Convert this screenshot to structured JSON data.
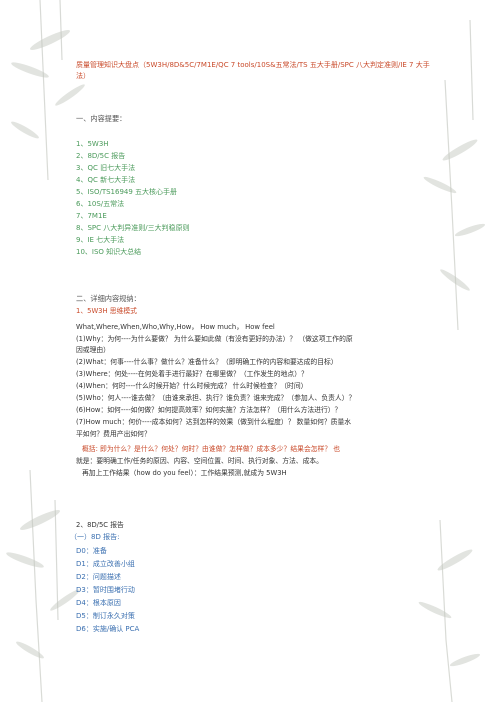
{
  "title": "质量管理知识大盘点（5W3H/8D&5C/7M1E/QC 7 tools/10S&五常法/TS 五大手册/SPC 八大判定准则/IE 7 大手法）",
  "section1": {
    "heading": "一、内容提要：",
    "items": [
      "1、5W3H",
      "2、8D/5C 报告",
      "3、QC 旧七大手法",
      "4、QC 新七大手法",
      "5、ISO/TS16949 五大核心手册",
      "6、10S/五常法",
      "7、7M1E",
      "8、SPC 八大判异准则/三大判稳原则",
      "9、IE 七大手法",
      "10、ISO 知识大总结"
    ]
  },
  "section2": {
    "heading": "二、详细内容规纳：",
    "sub1": "1、5W3H 思维模式",
    "lines": {
      "intro": "What,Where,When,Who,Why,How， How much， How feel",
      "why_a": "(1)Why：为何----为什么要做？  为什么要如此做（有没有更好的办法）？  （做这项工作的原",
      "why_b": "因或理由）",
      "what": "(2)What：何事----什么事？做什么？准备什么？（即明确工作的内容和要达成的目标）",
      "where": "(3)Where：何处----在何处着手进行最好？在哪里做？（工作发生的地点）？",
      "when": "(4)When：何时----什么时候开始？什么时候完成？  什么时候检查？（时间）",
      "who": "(5)Who：何人----谁去做？（由谁来承担、执行？谁负责？谁来完成？（参加人、负责人）？",
      "how": "(6)How：如何----如何做？如何提高效率？如何实施？方法怎样？（用什么方法进行）？",
      "howmuch_a": "(7)How  much：何价----成本如何？达到怎样的效果（做到什么程度）？  数量如何？质量水",
      "howmuch_b": "平如何？费用产出如何？",
      "summary_a": "概括: 即为什么？是什么？何处？何时？由谁做？怎样做？成本多少？结果会怎样？  也",
      "summary_b": "就是：要明确工作/任务的原因、内容、空间位置、时间、执行对象、方法、成本。",
      "summary_c": "再加上工作结果（how do you feel）：工作结果预测,就成为 5W3H"
    },
    "sub2": "2、8D/5C 报告",
    "sub2a": "（一）8D 报告:",
    "d_items": [
      "D0：准备",
      "D1：成立改善小组",
      "D2：问题描述",
      "D3：暂时围堵行动",
      "D4：根本原因",
      "D5：制订永久对策",
      "D6：实施/确认 PCA"
    ]
  }
}
